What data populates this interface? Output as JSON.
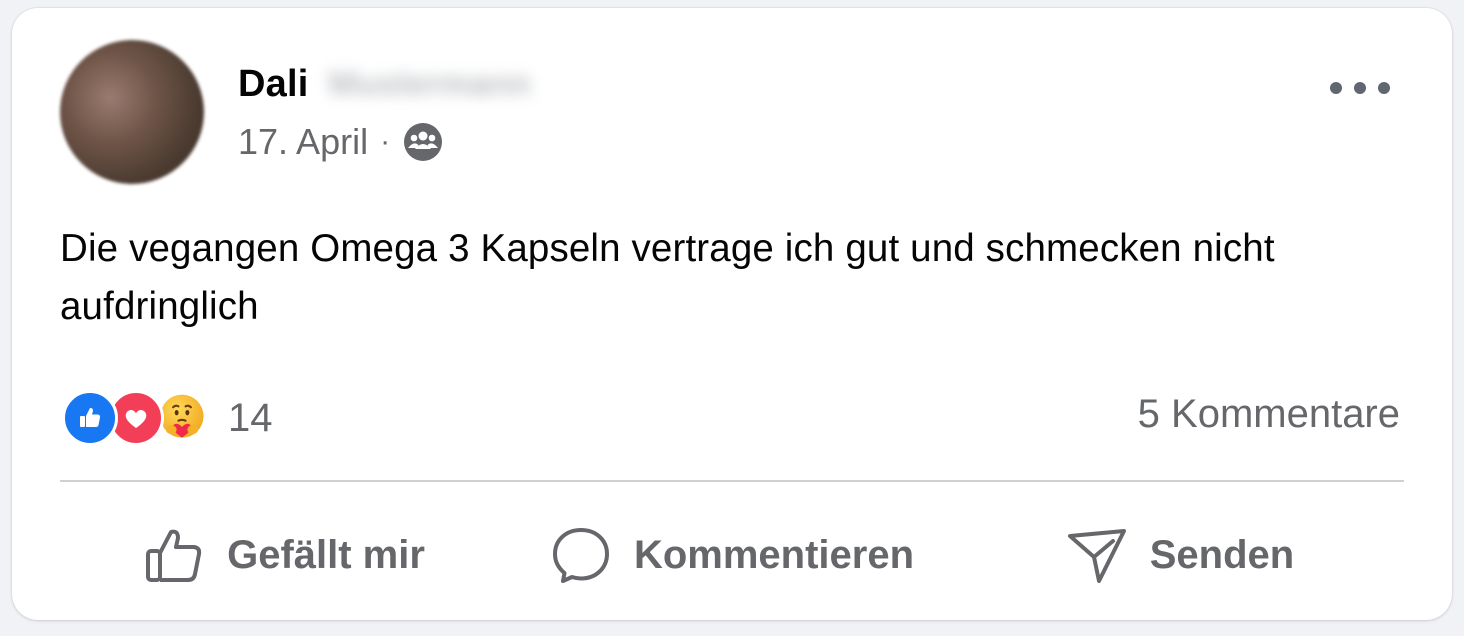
{
  "post": {
    "author_first_name": "Dali",
    "author_last_name_blurred": "Mustermann",
    "date": "17. April",
    "meta_separator": "·",
    "audience_icon": "group-icon",
    "text": "Die vegangen Omega 3 Kapseln vertrage ich gut und schmecken nicht aufdringlich",
    "more_icon": "more-horizontal-icon"
  },
  "reactions": {
    "types": [
      "like",
      "love",
      "care"
    ],
    "count": "14"
  },
  "comments": {
    "label": "5 Kommentare"
  },
  "actions": {
    "like_label": "Gefällt mir",
    "comment_label": "Kommentieren",
    "share_label": "Senden"
  },
  "colors": {
    "like_blue": "#1877f2",
    "love_red": "#f33e58",
    "secondary_text": "#65676b",
    "primary_text": "#050505",
    "divider": "#ced0d4"
  }
}
